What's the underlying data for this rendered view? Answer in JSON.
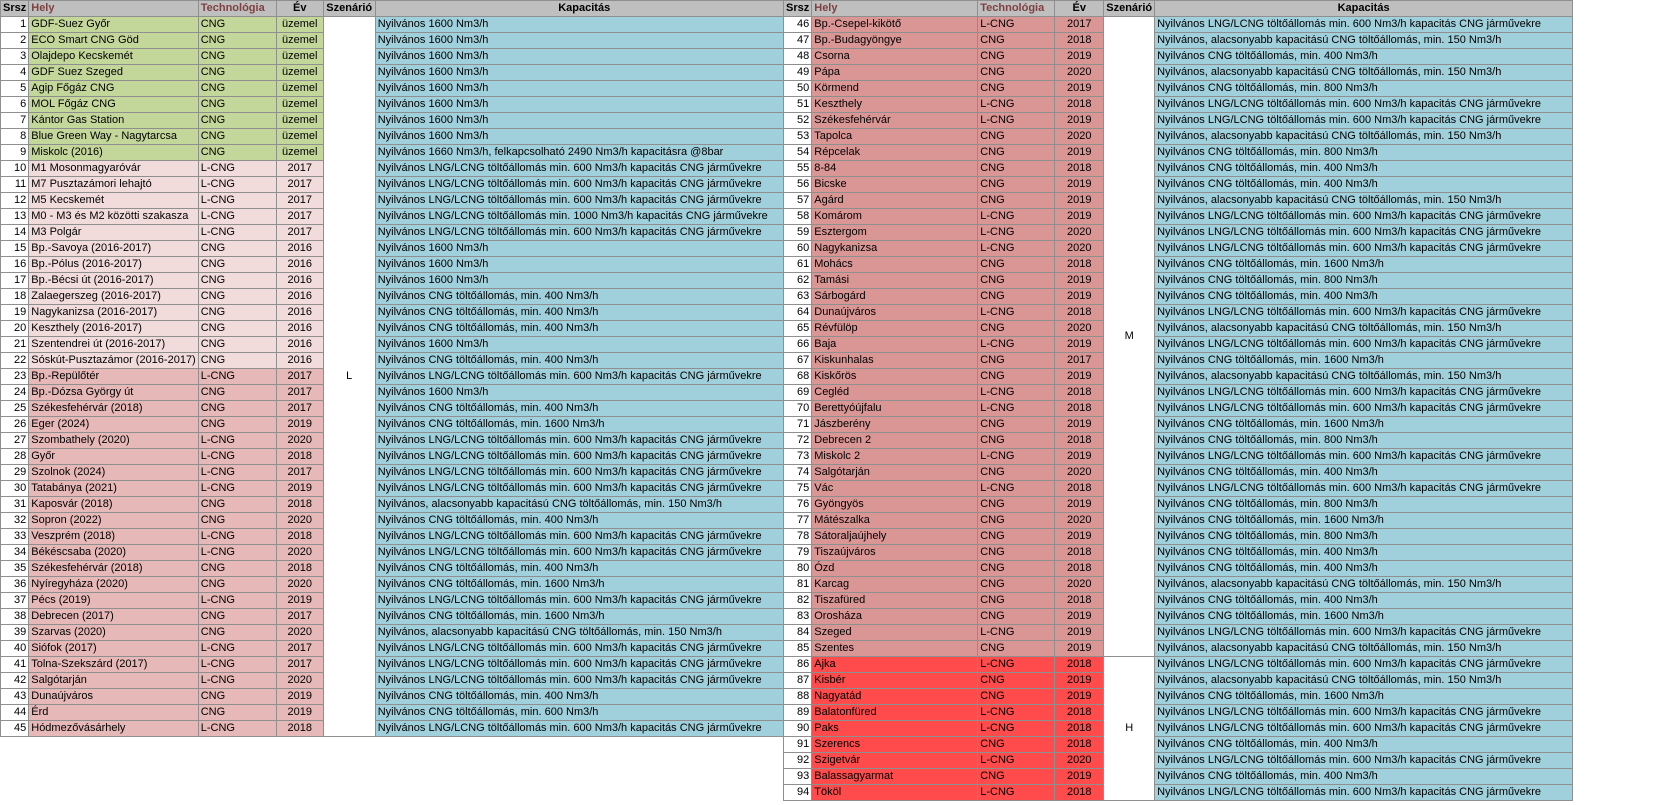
{
  "headers": {
    "srsz": "Srsz",
    "hely": "Hely",
    "tech": "Technológia",
    "ev": "Év",
    "scen": "Szenárió",
    "kap": "Kapacitás"
  },
  "colors": {
    "green": "#c4d79b",
    "pink": "#f2dcdb",
    "salmon": "#e6b8b7",
    "rose": "#da9694",
    "red": "#ff4b4b",
    "capacity": "#9fd0dc",
    "header": "#bfbfbf"
  },
  "left_rows": [
    {
      "n": "1",
      "hely": "GDF-Suez Győr",
      "tech": "CNG",
      "ev": "üzemel",
      "kap": "Nyilvános 1600 Nm3/h",
      "tone": "green"
    },
    {
      "n": "2",
      "hely": "ECO Smart CNG Göd",
      "tech": "CNG",
      "ev": "üzemel",
      "kap": "Nyilvános 1600 Nm3/h",
      "tone": "green"
    },
    {
      "n": "3",
      "hely": "Olajdepo Kecskemét",
      "tech": "CNG",
      "ev": "üzemel",
      "kap": "Nyilvános 1600 Nm3/h",
      "tone": "green"
    },
    {
      "n": "4",
      "hely": "GDF Suez Szeged",
      "tech": "CNG",
      "ev": "üzemel",
      "kap": "Nyilvános 1600 Nm3/h",
      "tone": "green"
    },
    {
      "n": "5",
      "hely": "Agip Főgáz CNG",
      "tech": "CNG",
      "ev": "üzemel",
      "kap": "Nyilvános 1600 Nm3/h",
      "tone": "green"
    },
    {
      "n": "6",
      "hely": "MOL Főgáz CNG",
      "tech": "CNG",
      "ev": "üzemel",
      "kap": "Nyilvános 1600 Nm3/h",
      "tone": "green"
    },
    {
      "n": "7",
      "hely": "Kántor Gas Station",
      "tech": "CNG",
      "ev": "üzemel",
      "kap": "Nyilvános 1600 Nm3/h",
      "tone": "green"
    },
    {
      "n": "8",
      "hely": "Blue Green Way - Nagytarcsa",
      "tech": "CNG",
      "ev": "üzemel",
      "kap": "Nyilvános 1600 Nm3/h",
      "tone": "green"
    },
    {
      "n": "9",
      "hely": "Miskolc (2016)",
      "tech": "CNG",
      "ev": "üzemel",
      "kap": "Nyilvános 1660 Nm3/h, felkapcsolható 2490 Nm3/h kapacitásra @8bar",
      "tone": "green"
    },
    {
      "n": "10",
      "hely": "M1 Mosonmagyaróvár",
      "tech": "L-CNG",
      "ev": "2017",
      "kap": "Nyilvános LNG/LCNG töltőállomás min. 600 Nm3/h kapacitás CNG járművekre",
      "tone": "pink"
    },
    {
      "n": "11",
      "hely": "M7 Pusztazámori lehajtó",
      "tech": "L-CNG",
      "ev": "2017",
      "kap": "Nyilvános LNG/LCNG töltőállomás min. 600 Nm3/h kapacitás CNG járművekre",
      "tone": "pink"
    },
    {
      "n": "12",
      "hely": "M5 Kecskemét",
      "tech": "L-CNG",
      "ev": "2017",
      "kap": "Nyilvános LNG/LCNG töltőállomás min. 600 Nm3/h kapacitás CNG járművekre",
      "tone": "pink"
    },
    {
      "n": "13",
      "hely": "M0 - M3 és M2 közötti szakasza",
      "tech": "L-CNG",
      "ev": "2017",
      "kap": "Nyilvános LNG/LCNG töltőállomás min. 1000 Nm3/h kapacitás CNG járművekre",
      "tone": "pink"
    },
    {
      "n": "14",
      "hely": "M3 Polgár",
      "tech": "L-CNG",
      "ev": "2017",
      "kap": "Nyilvános LNG/LCNG töltőállomás min. 600 Nm3/h kapacitás CNG járművekre",
      "tone": "pink"
    },
    {
      "n": "15",
      "hely": "Bp.-Savoya (2016-2017)",
      "tech": "CNG",
      "ev": "2016",
      "kap": "Nyilvános 1600 Nm3/h",
      "tone": "pink"
    },
    {
      "n": "16",
      "hely": "Bp.-Pólus (2016-2017)",
      "tech": "CNG",
      "ev": "2016",
      "kap": "Nyilvános 1600 Nm3/h",
      "tone": "pink"
    },
    {
      "n": "17",
      "hely": "Bp.-Bécsi út (2016-2017)",
      "tech": "CNG",
      "ev": "2016",
      "kap": "Nyilvános 1600 Nm3/h",
      "tone": "pink"
    },
    {
      "n": "18",
      "hely": "Zalaegerszeg (2016-2017)",
      "tech": "CNG",
      "ev": "2016",
      "kap": "Nyilvános CNG töltőállomás, min. 400 Nm3/h",
      "tone": "pink"
    },
    {
      "n": "19",
      "hely": "Nagykanizsa (2016-2017)",
      "tech": "CNG",
      "ev": "2016",
      "kap": "Nyilvános CNG töltőállomás, min. 400 Nm3/h",
      "tone": "pink"
    },
    {
      "n": "20",
      "hely": "Keszthely (2016-2017)",
      "tech": "CNG",
      "ev": "2016",
      "kap": "Nyilvános CNG töltőállomás, min. 400 Nm3/h",
      "tone": "pink"
    },
    {
      "n": "21",
      "hely": "Szentendrei út (2016-2017)",
      "tech": "CNG",
      "ev": "2016",
      "kap": "Nyilvános 1600 Nm3/h",
      "tone": "pink"
    },
    {
      "n": "22",
      "hely": "Sóskút-Pusztazámor (2016-2017)",
      "tech": "CNG",
      "ev": "2016",
      "kap": "Nyilvános CNG töltőállomás, min. 400 Nm3/h",
      "tone": "pink"
    },
    {
      "n": "23",
      "hely": "Bp.-Repülőtér",
      "tech": "L-CNG",
      "ev": "2017",
      "kap": "Nyilvános LNG/LCNG töltőállomás min. 600 Nm3/h kapacitás CNG járművekre",
      "tone": "salmon"
    },
    {
      "n": "24",
      "hely": "Bp.-Dózsa György út",
      "tech": "CNG",
      "ev": "2017",
      "kap": "Nyilvános 1600 Nm3/h",
      "tone": "salmon"
    },
    {
      "n": "25",
      "hely": "Székesfehérvár (2018)",
      "tech": "CNG",
      "ev": "2017",
      "kap": "Nyilvános CNG töltőállomás, min. 400 Nm3/h",
      "tone": "salmon"
    },
    {
      "n": "26",
      "hely": "Eger (2024)",
      "tech": "CNG",
      "ev": "2019",
      "kap": "Nyilvános CNG töltőállomás, min. 1600 Nm3/h",
      "tone": "salmon"
    },
    {
      "n": "27",
      "hely": "Szombathely (2020)",
      "tech": "L-CNG",
      "ev": "2020",
      "kap": "Nyilvános LNG/LCNG töltőállomás min. 600 Nm3/h kapacitás CNG járművekre",
      "tone": "salmon"
    },
    {
      "n": "28",
      "hely": "Győr",
      "tech": "L-CNG",
      "ev": "2018",
      "kap": "Nyilvános LNG/LCNG töltőállomás min. 600 Nm3/h kapacitás CNG járművekre",
      "tone": "salmon"
    },
    {
      "n": "29",
      "hely": "Szolnok (2024)",
      "tech": "L-CNG",
      "ev": "2017",
      "kap": "Nyilvános LNG/LCNG töltőállomás min. 600 Nm3/h kapacitás CNG járművekre",
      "tone": "salmon"
    },
    {
      "n": "30",
      "hely": "Tatabánya (2021)",
      "tech": "L-CNG",
      "ev": "2019",
      "kap": "Nyilvános LNG/LCNG töltőállomás min. 600 Nm3/h kapacitás CNG járművekre",
      "tone": "salmon"
    },
    {
      "n": "31",
      "hely": "Kaposvár (2018)",
      "tech": "CNG",
      "ev": "2018",
      "kap": "Nyilvános, alacsonyabb kapacitású CNG töltőállomás, min. 150 Nm3/h",
      "tone": "salmon"
    },
    {
      "n": "32",
      "hely": "Sopron (2022)",
      "tech": "CNG",
      "ev": "2020",
      "kap": "Nyilvános CNG töltőállomás, min. 400 Nm3/h",
      "tone": "salmon"
    },
    {
      "n": "33",
      "hely": "Veszprém (2018)",
      "tech": "L-CNG",
      "ev": "2018",
      "kap": "Nyilvános LNG/LCNG töltőállomás min. 600 Nm3/h kapacitás CNG járművekre",
      "tone": "salmon"
    },
    {
      "n": "34",
      "hely": "Békéscsaba (2020)",
      "tech": "L-CNG",
      "ev": "2020",
      "kap": "Nyilvános LNG/LCNG töltőállomás min. 600 Nm3/h kapacitás CNG járművekre",
      "tone": "salmon"
    },
    {
      "n": "35",
      "hely": "Székesfehérvár (2018)",
      "tech": "CNG",
      "ev": "2018",
      "kap": "Nyilvános CNG töltőállomás, min. 400 Nm3/h",
      "tone": "salmon"
    },
    {
      "n": "36",
      "hely": "Nyíregyháza (2020)",
      "tech": "CNG",
      "ev": "2020",
      "kap": "Nyilvános CNG töltőállomás, min. 1600 Nm3/h",
      "tone": "salmon"
    },
    {
      "n": "37",
      "hely": "Pécs (2019)",
      "tech": "L-CNG",
      "ev": "2019",
      "kap": "Nyilvános LNG/LCNG töltőállomás min. 600 Nm3/h kapacitás CNG járművekre",
      "tone": "salmon"
    },
    {
      "n": "38",
      "hely": "Debrecen (2017)",
      "tech": "CNG",
      "ev": "2017",
      "kap": "Nyilvános CNG töltőállomás, min. 1600 Nm3/h",
      "tone": "salmon"
    },
    {
      "n": "39",
      "hely": "Szarvas (2020)",
      "tech": "CNG",
      "ev": "2020",
      "kap": "Nyilvános, alacsonyabb kapacitású CNG töltőállomás, min. 150 Nm3/h",
      "tone": "salmon"
    },
    {
      "n": "40",
      "hely": "Siófok (2017)",
      "tech": "L-CNG",
      "ev": "2017",
      "kap": "Nyilvános LNG/LCNG töltőállomás min. 600 Nm3/h kapacitás CNG járművekre",
      "tone": "salmon"
    },
    {
      "n": "41",
      "hely": "Tolna-Szekszárd (2017)",
      "tech": "L-CNG",
      "ev": "2017",
      "kap": "Nyilvános LNG/LCNG töltőállomás min. 600 Nm3/h kapacitás CNG járművekre",
      "tone": "salmon"
    },
    {
      "n": "42",
      "hely": "Salgótarján",
      "tech": "L-CNG",
      "ev": "2020",
      "kap": "Nyilvános LNG/LCNG töltőállomás min. 600 Nm3/h kapacitás CNG járművekre",
      "tone": "salmon"
    },
    {
      "n": "43",
      "hely": "Dunaújváros",
      "tech": "CNG",
      "ev": "2019",
      "kap": "Nyilvános CNG töltőállomás, min. 400 Nm3/h",
      "tone": "salmon"
    },
    {
      "n": "44",
      "hely": "Érd",
      "tech": "CNG",
      "ev": "2019",
      "kap": "Nyilvános CNG töltőállomás, min. 600 Nm3/h",
      "tone": "salmon"
    },
    {
      "n": "45",
      "hely": "Hódmezővásárhely",
      "tech": "L-CNG",
      "ev": "2018",
      "kap": "Nyilvános LNG/LCNG töltőállomás min. 600 Nm3/h kapacitás CNG járművekre",
      "tone": "salmon"
    }
  ],
  "right_rows": [
    {
      "n": "46",
      "hely": "Bp.-Csepel-kikötő",
      "tech": "L-CNG",
      "ev": "2017",
      "kap": "Nyilvános LNG/LCNG töltőállomás min. 600 Nm3/h kapacitás CNG járművekre",
      "tone": "rose"
    },
    {
      "n": "47",
      "hely": "Bp.-Budagyöngye",
      "tech": "CNG",
      "ev": "2018",
      "kap": "Nyilvános, alacsonyabb kapacitású CNG töltőállomás, min. 150 Nm3/h",
      "tone": "rose"
    },
    {
      "n": "48",
      "hely": "Csorna",
      "tech": "CNG",
      "ev": "2019",
      "kap": "Nyilvános CNG töltőállomás, min. 400 Nm3/h",
      "tone": "rose"
    },
    {
      "n": "49",
      "hely": "Pápa",
      "tech": "CNG",
      "ev": "2020",
      "kap": "Nyilvános, alacsonyabb kapacitású CNG töltőállomás, min. 150 Nm3/h",
      "tone": "rose"
    },
    {
      "n": "50",
      "hely": "Körmend",
      "tech": "CNG",
      "ev": "2019",
      "kap": "Nyilvános CNG töltőállomás, min. 800 Nm3/h",
      "tone": "rose"
    },
    {
      "n": "51",
      "hely": "Keszthely",
      "tech": "L-CNG",
      "ev": "2018",
      "kap": "Nyilvános LNG/LCNG töltőállomás min. 600 Nm3/h kapacitás CNG járművekre",
      "tone": "rose"
    },
    {
      "n": "52",
      "hely": "Székesfehérvár",
      "tech": "L-CNG",
      "ev": "2019",
      "kap": "Nyilvános LNG/LCNG töltőállomás min. 600 Nm3/h kapacitás CNG járművekre",
      "tone": "rose"
    },
    {
      "n": "53",
      "hely": "Tapolca",
      "tech": "CNG",
      "ev": "2020",
      "kap": "Nyilvános, alacsonyabb kapacitású CNG töltőállomás, min. 150 Nm3/h",
      "tone": "rose"
    },
    {
      "n": "54",
      "hely": "Répcelak",
      "tech": "CNG",
      "ev": "2019",
      "kap": "Nyilvános CNG töltőállomás, min. 800 Nm3/h",
      "tone": "rose"
    },
    {
      "n": "55",
      "hely": "8-84",
      "tech": "CNG",
      "ev": "2018",
      "kap": "Nyilvános CNG töltőállomás, min. 400 Nm3/h",
      "tone": "rose"
    },
    {
      "n": "56",
      "hely": "Bicske",
      "tech": "CNG",
      "ev": "2019",
      "kap": "Nyilvános CNG töltőállomás, min. 400 Nm3/h",
      "tone": "rose"
    },
    {
      "n": "57",
      "hely": "Agárd",
      "tech": "CNG",
      "ev": "2019",
      "kap": "Nyilvános, alacsonyabb kapacitású CNG töltőállomás, min. 150 Nm3/h",
      "tone": "rose"
    },
    {
      "n": "58",
      "hely": "Komárom",
      "tech": "L-CNG",
      "ev": "2019",
      "kap": "Nyilvános LNG/LCNG töltőállomás min. 600 Nm3/h kapacitás CNG járművekre",
      "tone": "rose"
    },
    {
      "n": "59",
      "hely": "Esztergom",
      "tech": "L-CNG",
      "ev": "2020",
      "kap": "Nyilvános LNG/LCNG töltőállomás min. 600 Nm3/h kapacitás CNG járművekre",
      "tone": "rose"
    },
    {
      "n": "60",
      "hely": "Nagykanizsa",
      "tech": "L-CNG",
      "ev": "2020",
      "kap": "Nyilvános LNG/LCNG töltőállomás min. 600 Nm3/h kapacitás CNG járművekre",
      "tone": "rose"
    },
    {
      "n": "61",
      "hely": "Mohács",
      "tech": "CNG",
      "ev": "2018",
      "kap": "Nyilvános CNG töltőállomás, min. 1600 Nm3/h",
      "tone": "rose"
    },
    {
      "n": "62",
      "hely": "Tamási",
      "tech": "CNG",
      "ev": "2019",
      "kap": "Nyilvános CNG töltőállomás, min. 800 Nm3/h",
      "tone": "rose"
    },
    {
      "n": "63",
      "hely": "Sárbogárd",
      "tech": "CNG",
      "ev": "2019",
      "kap": "Nyilvános CNG töltőállomás, min. 400 Nm3/h",
      "tone": "rose"
    },
    {
      "n": "64",
      "hely": "Dunaújváros",
      "tech": "L-CNG",
      "ev": "2018",
      "kap": "Nyilvános LNG/LCNG töltőállomás min. 600 Nm3/h kapacitás CNG járművekre",
      "tone": "rose"
    },
    {
      "n": "65",
      "hely": "Révfülöp",
      "tech": "CNG",
      "ev": "2020",
      "kap": "Nyilvános, alacsonyabb kapacitású CNG töltőállomás, min. 150 Nm3/h",
      "tone": "rose"
    },
    {
      "n": "66",
      "hely": "Baja",
      "tech": "L-CNG",
      "ev": "2019",
      "kap": "Nyilvános LNG/LCNG töltőállomás min. 600 Nm3/h kapacitás CNG járművekre",
      "tone": "rose"
    },
    {
      "n": "67",
      "hely": "Kiskunhalas",
      "tech": "CNG",
      "ev": "2017",
      "kap": "Nyilvános CNG töltőállomás, min. 1600 Nm3/h",
      "tone": "rose"
    },
    {
      "n": "68",
      "hely": "Kiskőrös",
      "tech": "CNG",
      "ev": "2019",
      "kap": "Nyilvános, alacsonyabb kapacitású CNG töltőállomás, min. 150 Nm3/h",
      "tone": "rose"
    },
    {
      "n": "69",
      "hely": "Cegléd",
      "tech": "L-CNG",
      "ev": "2018",
      "kap": "Nyilvános LNG/LCNG töltőállomás min. 600 Nm3/h kapacitás CNG járművekre",
      "tone": "rose"
    },
    {
      "n": "70",
      "hely": "Berettyóújfalu",
      "tech": "L-CNG",
      "ev": "2018",
      "kap": "Nyilvános LNG/LCNG töltőállomás min. 600 Nm3/h kapacitás CNG járművekre",
      "tone": "rose"
    },
    {
      "n": "71",
      "hely": "Jászberény",
      "tech": "CNG",
      "ev": "2019",
      "kap": "Nyilvános CNG töltőállomás, min. 1600 Nm3/h",
      "tone": "rose"
    },
    {
      "n": "72",
      "hely": "Debrecen 2",
      "tech": "CNG",
      "ev": "2018",
      "kap": "Nyilvános CNG töltőállomás, min. 800 Nm3/h",
      "tone": "rose"
    },
    {
      "n": "73",
      "hely": "Miskolc 2",
      "tech": "L-CNG",
      "ev": "2019",
      "kap": "Nyilvános LNG/LCNG töltőállomás min. 600 Nm3/h kapacitás CNG járművekre",
      "tone": "rose"
    },
    {
      "n": "74",
      "hely": "Salgótarján",
      "tech": "CNG",
      "ev": "2020",
      "kap": "Nyilvános CNG töltőállomás, min. 400 Nm3/h",
      "tone": "rose"
    },
    {
      "n": "75",
      "hely": "Vác",
      "tech": "L-CNG",
      "ev": "2018",
      "kap": "Nyilvános LNG/LCNG töltőállomás min. 600 Nm3/h kapacitás CNG járművekre",
      "tone": "rose"
    },
    {
      "n": "76",
      "hely": "Gyöngyös",
      "tech": "CNG",
      "ev": "2019",
      "kap": "Nyilvános CNG töltőállomás, min. 800 Nm3/h",
      "tone": "rose"
    },
    {
      "n": "77",
      "hely": "Mátészalka",
      "tech": "CNG",
      "ev": "2020",
      "kap": "Nyilvános CNG töltőállomás, min. 1600 Nm3/h",
      "tone": "rose"
    },
    {
      "n": "78",
      "hely": "Sátoraljaújhely",
      "tech": "CNG",
      "ev": "2019",
      "kap": "Nyilvános CNG töltőállomás, min. 800 Nm3/h",
      "tone": "rose"
    },
    {
      "n": "79",
      "hely": "Tiszaújváros",
      "tech": "CNG",
      "ev": "2018",
      "kap": "Nyilvános CNG töltőállomás, min. 400 Nm3/h",
      "tone": "rose"
    },
    {
      "n": "80",
      "hely": "Ózd",
      "tech": "CNG",
      "ev": "2018",
      "kap": "Nyilvános CNG töltőállomás, min. 400 Nm3/h",
      "tone": "rose"
    },
    {
      "n": "81",
      "hely": "Karcag",
      "tech": "CNG",
      "ev": "2020",
      "kap": "Nyilvános, alacsonyabb kapacitású CNG töltőállomás, min. 150 Nm3/h",
      "tone": "rose"
    },
    {
      "n": "82",
      "hely": "Tiszafüred",
      "tech": "CNG",
      "ev": "2018",
      "kap": "Nyilvános CNG töltőállomás, min. 400 Nm3/h",
      "tone": "rose"
    },
    {
      "n": "83",
      "hely": "Orosháza",
      "tech": "CNG",
      "ev": "2019",
      "kap": "Nyilvános CNG töltőállomás, min. 1600 Nm3/h",
      "tone": "rose"
    },
    {
      "n": "84",
      "hely": "Szeged",
      "tech": "L-CNG",
      "ev": "2019",
      "kap": "Nyilvános LNG/LCNG töltőállomás min. 600 Nm3/h kapacitás CNG járművekre",
      "tone": "rose"
    },
    {
      "n": "85",
      "hely": "Szentes",
      "tech": "CNG",
      "ev": "2019",
      "kap": "Nyilvános, alacsonyabb kapacitású CNG töltőállomás, min. 150 Nm3/h",
      "tone": "rose"
    },
    {
      "n": "86",
      "hely": "Ajka",
      "tech": "L-CNG",
      "ev": "2018",
      "kap": "Nyilvános LNG/LCNG töltőállomás min. 600 Nm3/h kapacitás CNG járművekre",
      "tone": "red"
    },
    {
      "n": "87",
      "hely": "Kisbér",
      "tech": "CNG",
      "ev": "2019",
      "kap": "Nyilvános, alacsonyabb kapacitású CNG töltőállomás, min. 150 Nm3/h",
      "tone": "red"
    },
    {
      "n": "88",
      "hely": "Nagyatád",
      "tech": "CNG",
      "ev": "2019",
      "kap": "Nyilvános CNG töltőállomás, min. 1600 Nm3/h",
      "tone": "red"
    },
    {
      "n": "89",
      "hely": "Balatonfüred",
      "tech": "L-CNG",
      "ev": "2018",
      "kap": "Nyilvános LNG/LCNG töltőállomás min. 600 Nm3/h kapacitás CNG járművekre",
      "tone": "red"
    },
    {
      "n": "90",
      "hely": "Paks",
      "tech": "L-CNG",
      "ev": "2018",
      "kap": "Nyilvános LNG/LCNG töltőállomás min. 600 Nm3/h kapacitás CNG járművekre",
      "tone": "red"
    },
    {
      "n": "91",
      "hely": "Szerencs",
      "tech": "CNG",
      "ev": "2018",
      "kap": "Nyilvános CNG töltőállomás, min. 400 Nm3/h",
      "tone": "red"
    },
    {
      "n": "92",
      "hely": "Szigetvár",
      "tech": "L-CNG",
      "ev": "2020",
      "kap": "Nyilvános LNG/LCNG töltőállomás min. 600 Nm3/h kapacitás CNG járművekre",
      "tone": "red"
    },
    {
      "n": "93",
      "hely": "Balassagyarmat",
      "tech": "CNG",
      "ev": "2019",
      "kap": "Nyilvános CNG töltőállomás, min. 400 Nm3/h",
      "tone": "red"
    },
    {
      "n": "94",
      "hely": "Tököl",
      "tech": "L-CNG",
      "ev": "2018",
      "kap": "Nyilvános LNG/LCNG töltőállomás min. 600 Nm3/h kapacitás CNG járművekre",
      "tone": "red"
    }
  ],
  "scenarios": {
    "left": "L",
    "right_top": "M",
    "right_bottom": "H"
  }
}
